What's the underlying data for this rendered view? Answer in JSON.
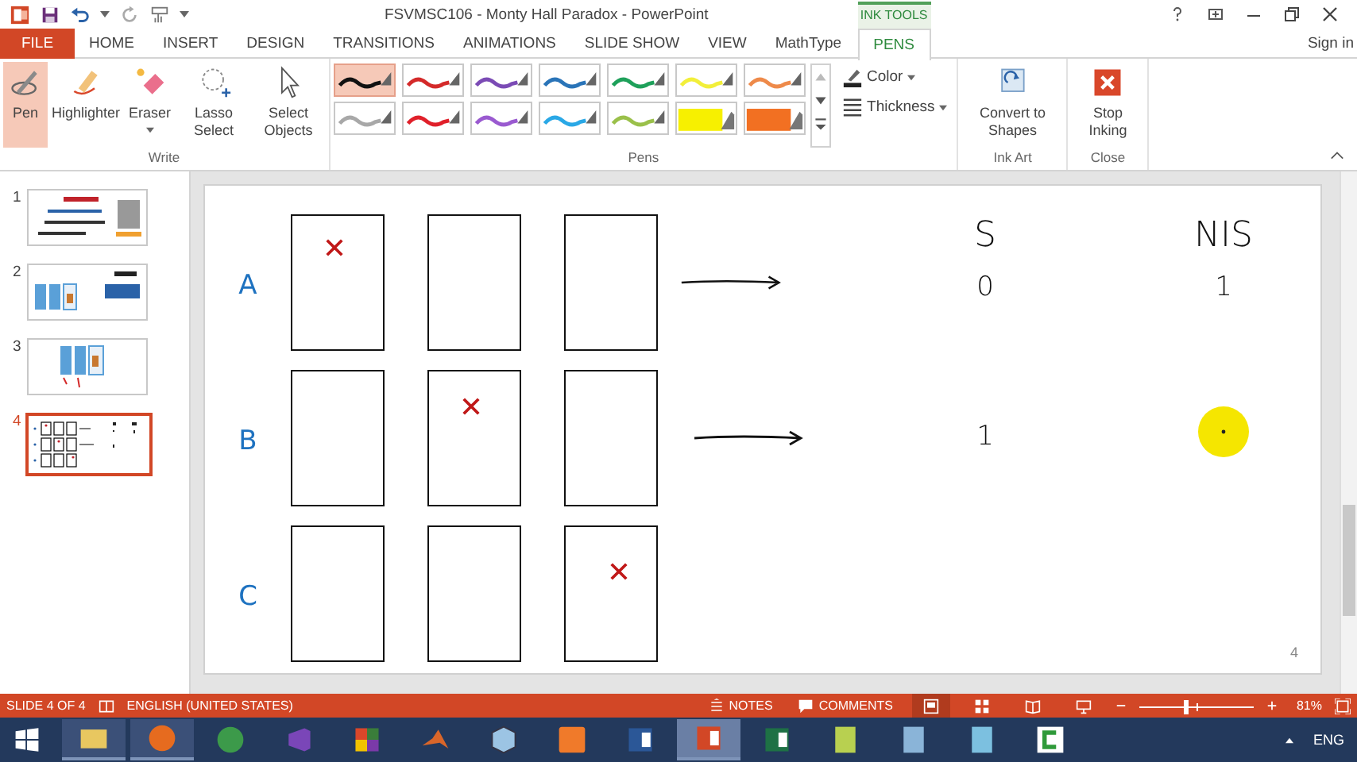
{
  "window": {
    "title": "FSVMSC106 - Monty Hall Paradox - PowerPoint",
    "sign_in": "Sign in"
  },
  "context_group": "INK TOOLS",
  "tabs": [
    {
      "label": "FILE",
      "kind": "file",
      "selected": false
    },
    {
      "label": "HOME",
      "kind": "tab",
      "selected": false
    },
    {
      "label": "INSERT",
      "kind": "tab",
      "selected": false
    },
    {
      "label": "DESIGN",
      "kind": "tab",
      "selected": false
    },
    {
      "label": "TRANSITIONS",
      "kind": "tab",
      "selected": false
    },
    {
      "label": "ANIMATIONS",
      "kind": "tab",
      "selected": false
    },
    {
      "label": "SLIDE SHOW",
      "kind": "tab",
      "selected": false
    },
    {
      "label": "VIEW",
      "kind": "tab",
      "selected": false
    },
    {
      "label": "MathType",
      "kind": "tab",
      "selected": false
    },
    {
      "label": "PENS",
      "kind": "context",
      "selected": true
    }
  ],
  "ribbon": {
    "write": {
      "label": "Write",
      "tools": [
        {
          "kind": "pen",
          "label": "Pen",
          "selected": true,
          "dropdown": false
        },
        {
          "kind": "highlighter",
          "label": "Highlighter",
          "selected": false,
          "dropdown": false
        },
        {
          "kind": "eraser",
          "label": "Eraser",
          "selected": false,
          "dropdown": true
        },
        {
          "kind": "lasso",
          "label": "Lasso Select",
          "selected": false,
          "dropdown": false
        },
        {
          "kind": "select",
          "label": "Select Objects",
          "selected": false,
          "dropdown": false
        }
      ]
    },
    "pens": {
      "label": "Pens",
      "swatches": [
        {
          "kind": "pen",
          "color": "#111111",
          "selected": true
        },
        {
          "kind": "pen",
          "color": "#d42a2a",
          "selected": false
        },
        {
          "kind": "pen",
          "color": "#7b4bb5",
          "selected": false
        },
        {
          "kind": "pen",
          "color": "#2a74b8",
          "selected": false
        },
        {
          "kind": "pen",
          "color": "#1ea05a",
          "selected": false
        },
        {
          "kind": "pen",
          "color": "#f2ef3a",
          "selected": false
        },
        {
          "kind": "pen",
          "color": "#ee8a4a",
          "selected": false
        },
        {
          "kind": "pen",
          "color": "#a8a8a8",
          "selected": false
        },
        {
          "kind": "pen",
          "color": "#e0202a",
          "selected": false
        },
        {
          "kind": "pen",
          "color": "#9a5ad0",
          "selected": false
        },
        {
          "kind": "pen",
          "color": "#2aa8e6",
          "selected": false
        },
        {
          "kind": "pen",
          "color": "#9ac04a",
          "selected": false
        },
        {
          "kind": "highlighter",
          "color": "#f7f000",
          "selected": false
        },
        {
          "kind": "highlighter",
          "color": "#f27022",
          "selected": false
        }
      ],
      "options": [
        "Color",
        "Thickness"
      ]
    },
    "ink_art": {
      "label": "Ink Art",
      "button": "Convert to Shapes"
    },
    "close": {
      "label": "Close",
      "button": "Stop Inking"
    }
  },
  "slides": [
    {
      "number": "1",
      "kind": "title",
      "selected": false
    },
    {
      "number": "2",
      "kind": "doors-sign",
      "selected": false
    },
    {
      "number": "3",
      "kind": "doors",
      "selected": false
    },
    {
      "number": "4",
      "kind": "grid",
      "selected": true
    }
  ],
  "slide": {
    "columns": [
      "S",
      "NIS"
    ],
    "page_number": "4",
    "rows": [
      {
        "label": "A",
        "doors": [
          {
            "marked": true
          },
          {
            "marked": false
          },
          {
            "marked": false
          }
        ],
        "arrow": true,
        "values": [
          "0",
          "1"
        ],
        "laser_pointer": false
      },
      {
        "label": "B",
        "doors": [
          {
            "marked": false
          },
          {
            "marked": true
          },
          {
            "marked": false
          }
        ],
        "arrow": true,
        "values": [
          "1"
        ],
        "laser_pointer": true
      },
      {
        "label": "C",
        "doors": [
          {
            "marked": false
          },
          {
            "marked": false
          },
          {
            "marked": true
          }
        ],
        "arrow": false,
        "values": [],
        "laser_pointer": false
      }
    ]
  },
  "status_bar": {
    "slide": "SLIDE 4 OF 4",
    "language": "ENGLISH (UNITED STATES)",
    "notes": "NOTES",
    "comments": "COMMENTS",
    "views": [
      {
        "kind": "normal",
        "selected": true
      },
      {
        "kind": "sorter",
        "selected": false
      },
      {
        "kind": "reading",
        "selected": false
      },
      {
        "kind": "show",
        "selected": false
      }
    ],
    "zoom": {
      "level": 0.4,
      "reading": "81%"
    }
  },
  "taskbar": {
    "apps": [
      {
        "kind": "explorer",
        "running": true,
        "selected": false
      },
      {
        "kind": "firefox",
        "running": true,
        "selected": false
      },
      {
        "kind": "chrome",
        "running": false,
        "selected": false
      },
      {
        "kind": "visualstudio",
        "running": false,
        "selected": false
      },
      {
        "kind": "blocks",
        "running": false,
        "selected": false
      },
      {
        "kind": "matlab",
        "running": false,
        "selected": false
      },
      {
        "kind": "cube",
        "running": false,
        "selected": false
      },
      {
        "kind": "xampp",
        "running": false,
        "selected": false
      },
      {
        "kind": "word",
        "running": false,
        "selected": false
      },
      {
        "kind": "powerpoint",
        "running": true,
        "selected": true
      },
      {
        "kind": "excel",
        "running": false,
        "selected": false
      },
      {
        "kind": "chart",
        "running": false,
        "selected": false
      },
      {
        "kind": "calculator",
        "running": false,
        "selected": false
      },
      {
        "kind": "notepad",
        "running": false,
        "selected": false
      },
      {
        "kind": "camtasia",
        "running": false,
        "selected": false
      }
    ],
    "language": "ENG"
  }
}
